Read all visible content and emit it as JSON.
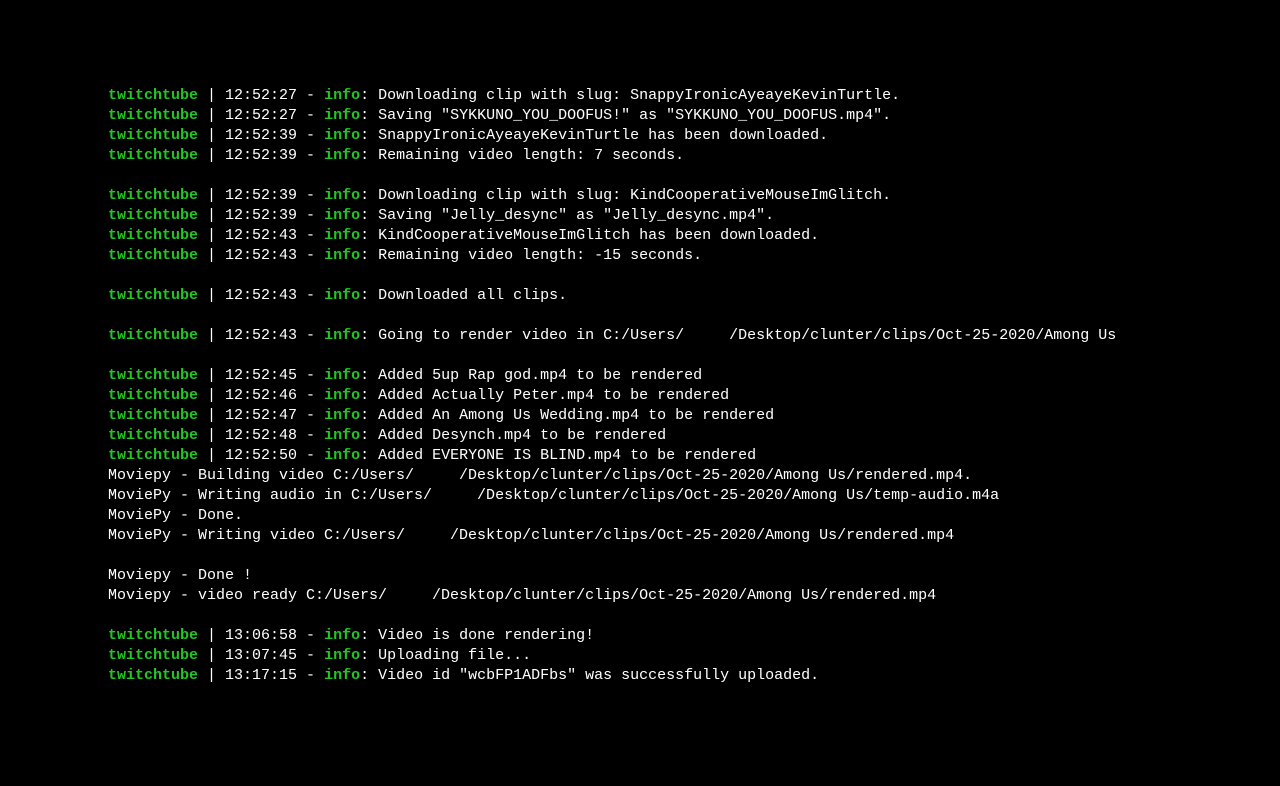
{
  "source_label": "twitchtube",
  "pipe": " | ",
  "dash": " - ",
  "level": "info",
  "colon": ": ",
  "lines": [
    {
      "type": "log",
      "time": "12:52:27",
      "msg": "Downloading clip with slug: SnappyIronicAyeayeKevinTurtle."
    },
    {
      "type": "log",
      "time": "12:52:27",
      "msg": "Saving \"SYKKUNO_YOU_DOOFUS!\" as \"SYKKUNO_YOU_DOOFUS.mp4\"."
    },
    {
      "type": "log",
      "time": "12:52:39",
      "msg": "SnappyIronicAyeayeKevinTurtle has been downloaded."
    },
    {
      "type": "log",
      "time": "12:52:39",
      "msg": "Remaining video length: 7 seconds."
    },
    {
      "type": "blank"
    },
    {
      "type": "log",
      "time": "12:52:39",
      "msg": "Downloading clip with slug: KindCooperativeMouseImGlitch."
    },
    {
      "type": "log",
      "time": "12:52:39",
      "msg": "Saving \"Jelly_desync\" as \"Jelly_desync.mp4\"."
    },
    {
      "type": "log",
      "time": "12:52:43",
      "msg": "KindCooperativeMouseImGlitch has been downloaded."
    },
    {
      "type": "log",
      "time": "12:52:43",
      "msg": "Remaining video length: -15 seconds."
    },
    {
      "type": "blank"
    },
    {
      "type": "log",
      "time": "12:52:43",
      "msg": "Downloaded all clips."
    },
    {
      "type": "blank"
    },
    {
      "type": "log",
      "time": "12:52:43",
      "msg": "Going to render video in C:/Users/     /Desktop/clunter/clips/Oct-25-2020/Among Us"
    },
    {
      "type": "blank"
    },
    {
      "type": "log",
      "time": "12:52:45",
      "msg": "Added 5up Rap god.mp4 to be rendered"
    },
    {
      "type": "log",
      "time": "12:52:46",
      "msg": "Added Actually Peter.mp4 to be rendered"
    },
    {
      "type": "log",
      "time": "12:52:47",
      "msg": "Added An Among Us Wedding.mp4 to be rendered"
    },
    {
      "type": "log",
      "time": "12:52:48",
      "msg": "Added Desynch.mp4 to be rendered"
    },
    {
      "type": "log",
      "time": "12:52:50",
      "msg": "Added EVERYONE IS BLIND.mp4 to be rendered"
    },
    {
      "type": "plain",
      "text": "Moviepy - Building video C:/Users/     /Desktop/clunter/clips/Oct-25-2020/Among Us/rendered.mp4."
    },
    {
      "type": "plain",
      "text": "MoviePy - Writing audio in C:/Users/     /Desktop/clunter/clips/Oct-25-2020/Among Us/temp-audio.m4a"
    },
    {
      "type": "plain",
      "text": "MoviePy - Done."
    },
    {
      "type": "plain",
      "text": "MoviePy - Writing video C:/Users/     /Desktop/clunter/clips/Oct-25-2020/Among Us/rendered.mp4"
    },
    {
      "type": "blank"
    },
    {
      "type": "plain",
      "text": "Moviepy - Done !"
    },
    {
      "type": "plain",
      "text": "Moviepy - video ready C:/Users/     /Desktop/clunter/clips/Oct-25-2020/Among Us/rendered.mp4"
    },
    {
      "type": "blank"
    },
    {
      "type": "log",
      "time": "13:06:58",
      "msg": "Video is done rendering!"
    },
    {
      "type": "log",
      "time": "13:07:45",
      "msg": "Uploading file..."
    },
    {
      "type": "log",
      "time": "13:17:15",
      "msg": "Video id \"wcbFP1ADFbs\" was successfully uploaded."
    }
  ]
}
